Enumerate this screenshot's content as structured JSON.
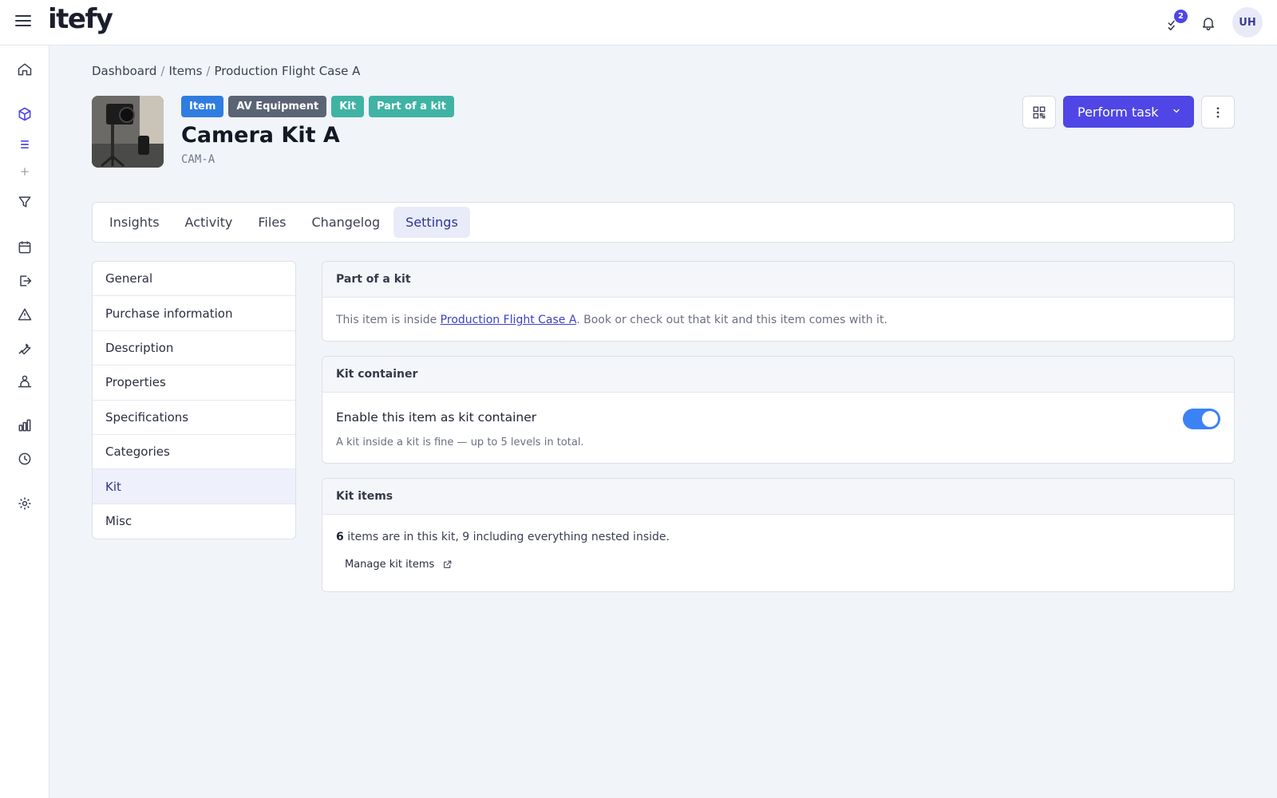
{
  "app": {
    "logo": "itefy",
    "notification_count": "2",
    "user_initials": "UH"
  },
  "breadcrumb": {
    "items": [
      "Dashboard",
      "Items",
      "Production Flight Case A"
    ],
    "separator": "/"
  },
  "item": {
    "tags": [
      "Item",
      "AV Equipment",
      "Kit",
      "Part of a kit"
    ],
    "title": "Camera Kit A",
    "code": "CAM-A"
  },
  "actions": {
    "perform_task": "Perform task"
  },
  "tabs": [
    "Insights",
    "Activity",
    "Files",
    "Changelog",
    "Settings"
  ],
  "active_tab": "Settings",
  "settings_nav": [
    "General",
    "Purchase information",
    "Description",
    "Properties",
    "Specifications",
    "Categories",
    "Kit",
    "Misc"
  ],
  "active_settings_nav": "Kit",
  "part_of_kit": {
    "heading": "Part of a kit",
    "text_before": "This item is inside ",
    "kit_name": "Production Flight Case A",
    "text_after": ". Book or check out that kit and this item comes with it."
  },
  "kit_container": {
    "heading": "Kit container",
    "toggle_label": "Enable this item as kit container",
    "toggle_on": true,
    "hint": "A kit inside a kit is fine — up to 5 levels in total."
  },
  "kit_items": {
    "heading": "Kit items",
    "count": "6",
    "summary": " items are in this kit, 9 including everything nested inside.",
    "manage_label": "Manage kit items"
  },
  "colors": {
    "primary": "#4f46e5",
    "toggle": "#3b82f6",
    "tag_blue": "#2f7de1",
    "tag_gray": "#5b6475",
    "tag_teal": "#3fb3a4"
  }
}
